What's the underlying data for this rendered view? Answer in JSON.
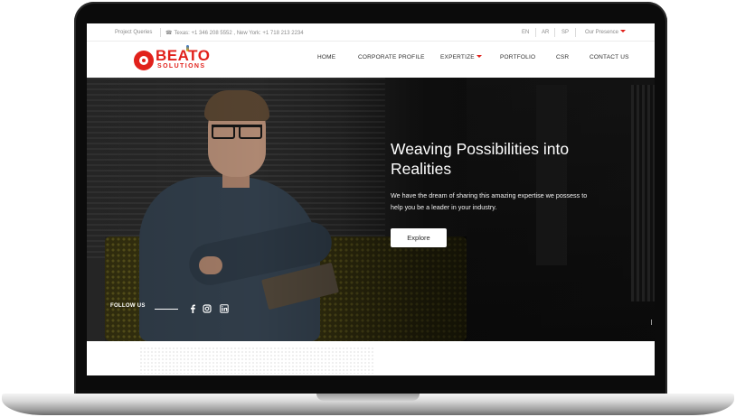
{
  "topbar": {
    "queries": "Project Queries",
    "contact": "Texas: +1 346 208 5552 , New York: +1 718 213 2234",
    "languages": [
      "EN",
      "AR",
      "SP"
    ],
    "presence": "Our Presence"
  },
  "logo": {
    "name": "BEATO",
    "sub": "SOLUTIONS"
  },
  "nav": {
    "items": [
      {
        "label": "HOME"
      },
      {
        "label": "CORPORATE PROFILE"
      },
      {
        "label": "EXPERTIZE"
      },
      {
        "label": "PORTFOLIO"
      },
      {
        "label": "CSR"
      },
      {
        "label": "CONTACT US"
      }
    ]
  },
  "hero": {
    "title_line1": "Weaving Possibilities into",
    "title_line2": "Realities",
    "text_line1": "We have the dream of sharing this amazing expertise we possess to",
    "text_line2": "help you be a leader in your industry.",
    "button": "Explore",
    "follow_label": "FOLLOW US"
  },
  "social": {
    "icons": [
      "facebook-icon",
      "instagram-icon",
      "linkedin-icon"
    ]
  },
  "colors": {
    "brand": "#e1211b",
    "hero_bg": "#1a1a1a"
  }
}
